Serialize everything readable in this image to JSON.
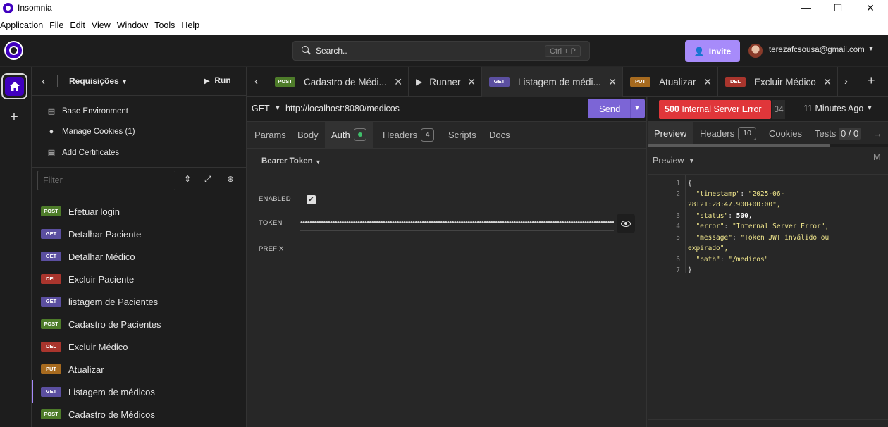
{
  "window": {
    "title": "Insomnia",
    "controls": {
      "minimize": "—",
      "maximize": "☐",
      "close": "✕"
    }
  },
  "menu": [
    "Application",
    "File",
    "Edit",
    "View",
    "Window",
    "Tools",
    "Help"
  ],
  "header": {
    "search_text": "Search..",
    "search_shortcut": "Ctrl + P",
    "invite_label": "Invite",
    "user_email": "terezafcsousa@gmail.com"
  },
  "sidebar": {
    "title": "Requisições",
    "run_label": "Run",
    "links": [
      {
        "label": "Base Environment",
        "icon": "document-icon"
      },
      {
        "label": "Manage Cookies (1)",
        "icon": "cookie-icon"
      },
      {
        "label": "Add Certificates",
        "icon": "certificate-icon"
      }
    ],
    "filter_placeholder": "Filter",
    "requests": [
      {
        "method": "POST",
        "name": "Efetuar login"
      },
      {
        "method": "GET",
        "name": "Detalhar Paciente"
      },
      {
        "method": "GET",
        "name": "Detalhar Médico"
      },
      {
        "method": "DEL",
        "name": "Excluir Paciente"
      },
      {
        "method": "GET",
        "name": "listagem de Pacientes"
      },
      {
        "method": "POST",
        "name": "Cadastro de Pacientes"
      },
      {
        "method": "DEL",
        "name": "Excluir Médico"
      },
      {
        "method": "PUT",
        "name": "Atualizar"
      },
      {
        "method": "GET",
        "name": "Listagem de médicos",
        "active": true
      },
      {
        "method": "POST",
        "name": "Cadastro de Médicos"
      }
    ]
  },
  "tabs": [
    {
      "method": "POST",
      "label": "Cadastro de Médi..."
    },
    {
      "method": "",
      "label": "Runner"
    },
    {
      "method": "GET",
      "label": "Listagem de médi...",
      "active": true
    },
    {
      "method": "PUT",
      "label": "Atualizar"
    },
    {
      "method": "DEL",
      "label": "Excluir Médico"
    }
  ],
  "request": {
    "method": "GET",
    "url": "http://localhost:8080/medicos",
    "send_label": "Send",
    "tabs": {
      "params": "Params",
      "body": "Body",
      "auth": "Auth",
      "headers": "Headers",
      "headers_count": "4",
      "scripts": "Scripts",
      "docs": "Docs"
    },
    "auth_type": "Bearer Token",
    "fields": {
      "enabled_label": "ENABLED",
      "token_label": "TOKEN",
      "prefix_label": "PREFIX",
      "enabled_check": "✔",
      "token_value": "••••••••••••••••••••••••••••••••••••••••••••••••••••••••••••••••••••••••••••••••••••••••••••••••••••••••••••••••••••••••••••••••••••••••••••"
    }
  },
  "response": {
    "status_code": "500",
    "status_text": "Internal Server Error",
    "size_fragment": "34",
    "time_ago": "11 Minutes Ago",
    "tabs": {
      "preview": "Preview",
      "headers": "Headers",
      "headers_count": "10",
      "cookies": "Cookies",
      "tests": "Tests",
      "tests_count": "0 / 0",
      "more": "→ M"
    },
    "preview_mode": "Preview",
    "code_lines": [
      {
        "n": "1",
        "text": "{"
      },
      {
        "n": "2",
        "key": "\"timestamp\"",
        "value": "\"2025-06-",
        "cont": "28T21:28:47.900+00:00\","
      },
      {
        "n": "3",
        "key": "\"status\"",
        "num": "500,"
      },
      {
        "n": "4",
        "key": "\"error\"",
        "value": "\"Internal Server Error\","
      },
      {
        "n": "5",
        "key": "\"message\"",
        "value": "\"Token JWT inválido ou",
        "cont": "expirado\","
      },
      {
        "n": "6",
        "key": "\"path\"",
        "value": "\"/medicos\""
      },
      {
        "n": "7",
        "text": "}"
      }
    ]
  },
  "colors": {
    "accent": "#a78bfa",
    "brand": "#4000bf",
    "post": "#4e7c2a",
    "get": "#5b4fa0",
    "del": "#a9352d",
    "put": "#a66a1f",
    "error": "#e0363a"
  }
}
